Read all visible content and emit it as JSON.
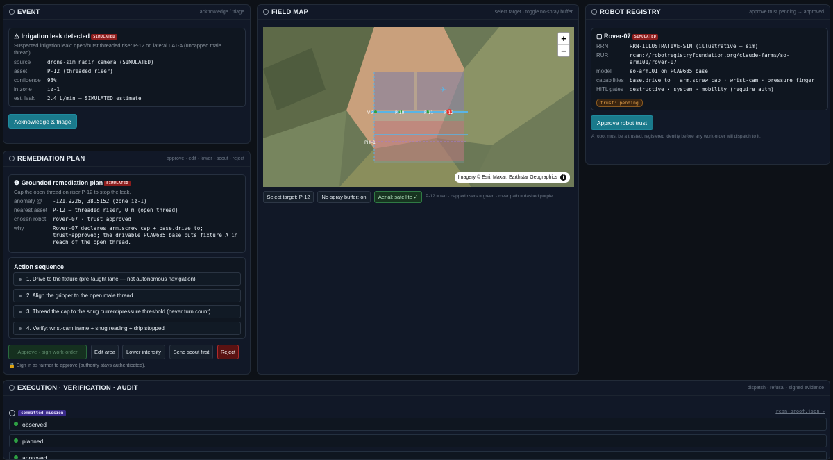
{
  "event": {
    "title": "EVENT",
    "actions": "acknowledge / triage",
    "card_title": "Irrigation leak detected",
    "badge": "SIMULATED",
    "description": "Suspected irrigation leak: open/burst threaded riser P-12 on lateral LAT-A (uncapped male thread).",
    "fields": [
      {
        "k": "source",
        "v": "drone-sim nadir camera (SIMULATED)"
      },
      {
        "k": "asset",
        "v": "P-12 (threaded_riser)"
      },
      {
        "k": "confidence",
        "v": "93%"
      },
      {
        "k": "in zone",
        "v": "iz-1"
      },
      {
        "k": "est. leak",
        "v": "2.4 L/min — SIMULATED estimate"
      }
    ],
    "button": "Acknowledge & triage"
  },
  "plan": {
    "title": "REMEDIATION PLAN",
    "actions": "approve · edit · lower · scout · reject",
    "card_title": "Grounded remediation plan",
    "badge": "SIMULATED",
    "description": "Cap the open thread on riser P-12 to stop the leak.",
    "fields": [
      {
        "k": "anomaly @",
        "v": "-121.9226, 38.5152 (zone iz-1)"
      },
      {
        "k": "nearest asset",
        "v": "P-12 — threaded_riser, 0 m (open_thread)"
      },
      {
        "k": "chosen robot",
        "v": "rover-07 · trust approved"
      },
      {
        "k": "why",
        "v": "Rover-07 declares arm.screw_cap + base.drive_to; trust=approved; the drivable PCA9685 base puts fixture_A in reach of the open thread."
      }
    ],
    "seq_title": "Action sequence",
    "steps": [
      "1. Drive to the fixture (pre-taught lane — not autonomous navigation)",
      "2. Align the gripper to the open male thread",
      "3. Thread the cap to the snug current/pressure threshold (never turn count)",
      "4. Verify: wrist-cam frame + snug reading + drip stopped"
    ],
    "buttons": {
      "approve": "Approve · sign work-order",
      "edit": "Edit area",
      "lower": "Lower intensity",
      "scout": "Send scout first",
      "reject": "Reject"
    },
    "note": "Sign in as farmer to approve (authority stays authenticated)."
  },
  "map": {
    "title": "FIELD MAP",
    "actions": "select target · toggle no-spray buffer",
    "attribution": "Imagery © Esri, Maxar, Earthstar Geographics",
    "zoom_in": "+",
    "zoom_out": "−",
    "labels": [
      "V-3",
      "P-10",
      "P-11",
      "P-12",
      "PHI-1"
    ],
    "buttons": {
      "target": "Select target: P-12",
      "buffer": "No-spray buffer: on",
      "aerial": "Aerial: satellite ✓"
    },
    "legend": "P-12 = red · capped risers = green · rover path = dashed purple"
  },
  "registry": {
    "title": "ROBOT REGISTRY",
    "actions": "approve trust pending → approved",
    "card_title": "Rover-07",
    "badge": "SIMULATED",
    "fields": [
      {
        "k": "RRN",
        "v": "RRN-ILLUSTRATIVE-SIM (illustrative — sim)"
      },
      {
        "k": "RURI",
        "v": "rcan://robotregistryfoundation.org/claude-farms/so-arm101/rover-07"
      },
      {
        "k": "model",
        "v": "so-arm101 on PCA9685 base"
      },
      {
        "k": "capabilities",
        "v": "base.drive_to · arm.screw_cap · wrist-cam · pressure finger"
      },
      {
        "k": "HITL gates",
        "v": "destructive · system · mobility (require auth)"
      }
    ],
    "trust": "trust: pending",
    "button": "Approve robot trust",
    "note": "A robot must be a trusted, registered identity before any work-order will dispatch to it."
  },
  "execution": {
    "title": "EXECUTION · VERIFICATION · AUDIT",
    "actions": "dispatch · refusal · signed evidence",
    "badge": "committed mission",
    "proof_link": "rcan-proof.json ↗",
    "rows": [
      "observed",
      "planned",
      "approved"
    ]
  }
}
